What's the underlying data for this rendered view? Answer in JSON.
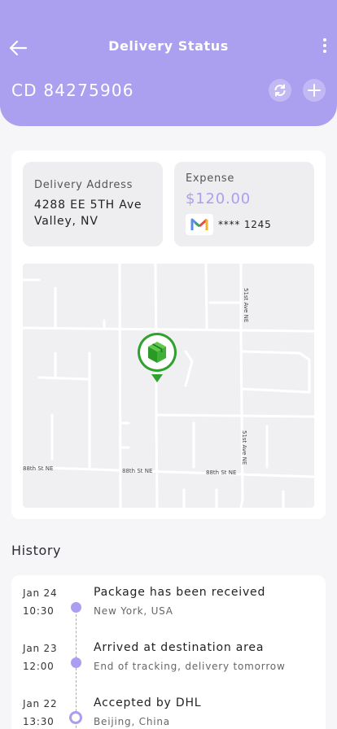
{
  "header": {
    "title": "Delivery Status",
    "tracking_number": "CD 84275906"
  },
  "colors": {
    "accent": "#ab9ff0",
    "pin_green": "#2fa12c"
  },
  "icons": {
    "back": "arrow-left-icon",
    "more": "more-vertical-icon",
    "refresh": "refresh-icon",
    "add": "plus-icon",
    "card_brand": "m-card-logo-icon",
    "map_pin": "package-pin-icon"
  },
  "delivery_address": {
    "label": "Delivery Address",
    "line1": "4288 EE 5TH Ave",
    "line2": "Valley, NV"
  },
  "expense": {
    "label": "Expense",
    "amount": "$120.00",
    "card_number": "**** 1245"
  },
  "map": {
    "street_labels": {
      "ave_top": "51st Ave NE",
      "ave_bottom": "51st Ave NE",
      "st_left": "88th St NE",
      "st_middle": "88th St NE",
      "st_right": "88th St NE"
    }
  },
  "history": {
    "title": "History",
    "items": [
      {
        "date": "Jan 24",
        "time": "10:30",
        "title": "Package has been received",
        "subtitle": "New York, USA"
      },
      {
        "date": "Jan 23",
        "time": "12:00",
        "title": "Arrived at destination area",
        "subtitle": "End of tracking, delivery tomorrow"
      },
      {
        "date": "Jan 22",
        "time": "13:30",
        "title": "Accepted by DHL",
        "subtitle": "Beijing, China"
      }
    ]
  }
}
